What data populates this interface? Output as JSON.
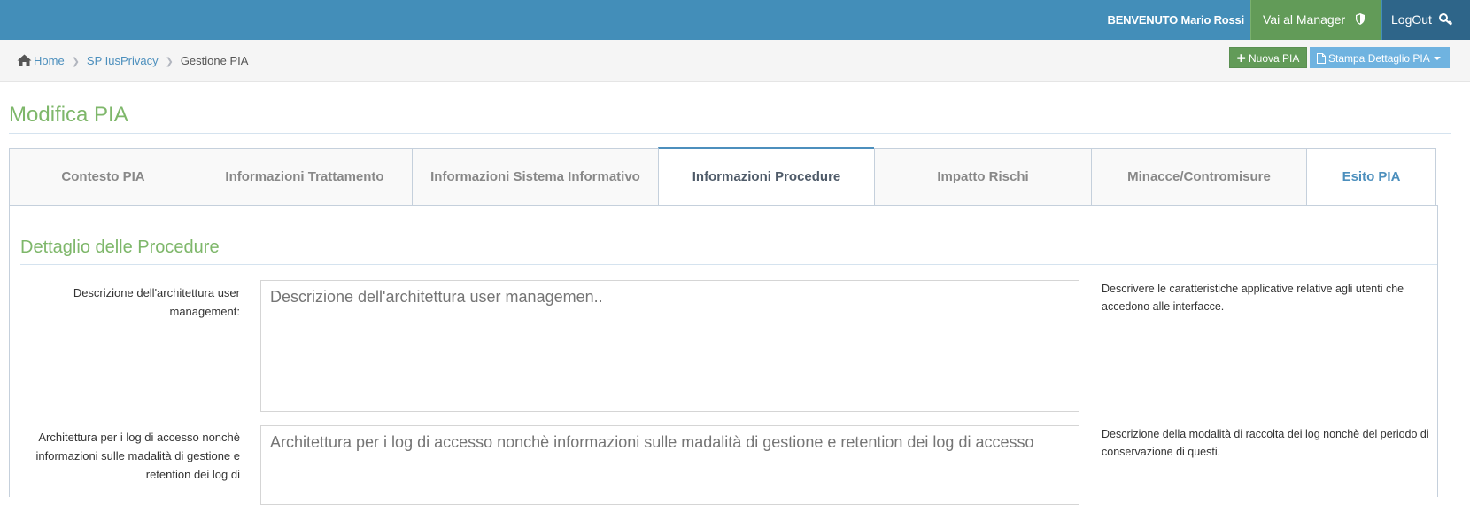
{
  "header": {
    "welcome_prefix": "BENVENUTO",
    "user_name": "Mario Rossi",
    "manager_label": "Vai al Manager",
    "logout_label": "LogOut",
    "bar_color": "#438eb9",
    "manager_color": "#629b58",
    "logout_color": "#2e6589"
  },
  "breadcrumb": {
    "items": [
      "Home",
      "SP IusPrivacy"
    ],
    "current": "Gestione PIA"
  },
  "toolbar": {
    "new_label": "Nuova PIA",
    "print_label": "Stampa Dettaglio PIA"
  },
  "page": {
    "title": "Modifica PIA"
  },
  "tabs": [
    {
      "label": "Contesto PIA"
    },
    {
      "label": "Informazioni Trattamento"
    },
    {
      "label": "Informazioni Sistema Informativo"
    },
    {
      "label": "Informazioni Procedure",
      "active": true
    },
    {
      "label": "Impatto Rischi"
    },
    {
      "label": "Minacce/Contromisure"
    },
    {
      "label": "Esito PIA"
    }
  ],
  "section": {
    "title": "Dettaglio delle Procedure",
    "fields": [
      {
        "label": "Descrizione dell'architettura user management:",
        "placeholder": "Descrizione dell'architettura user managemen..",
        "help": "Descrivere le caratteristiche applicative relative agli utenti che accedono alle interfacce."
      },
      {
        "label": "Architettura per i log di accesso nonchè informazioni sulle madalità di gestione e retention dei log di",
        "placeholder": "Architettura per i log di accesso nonchè informazioni sulle madalità di gestione e retention dei log di accesso",
        "help": "Descrizione della modalità di raccolta dei log nonchè del periodo di conservazione di questi."
      }
    ]
  },
  "icons": {
    "home": "home-icon",
    "shield": "shield-icon",
    "key": "key-icon",
    "plus": "plus-icon",
    "document": "document-icon",
    "caret": "caret-down-icon"
  }
}
